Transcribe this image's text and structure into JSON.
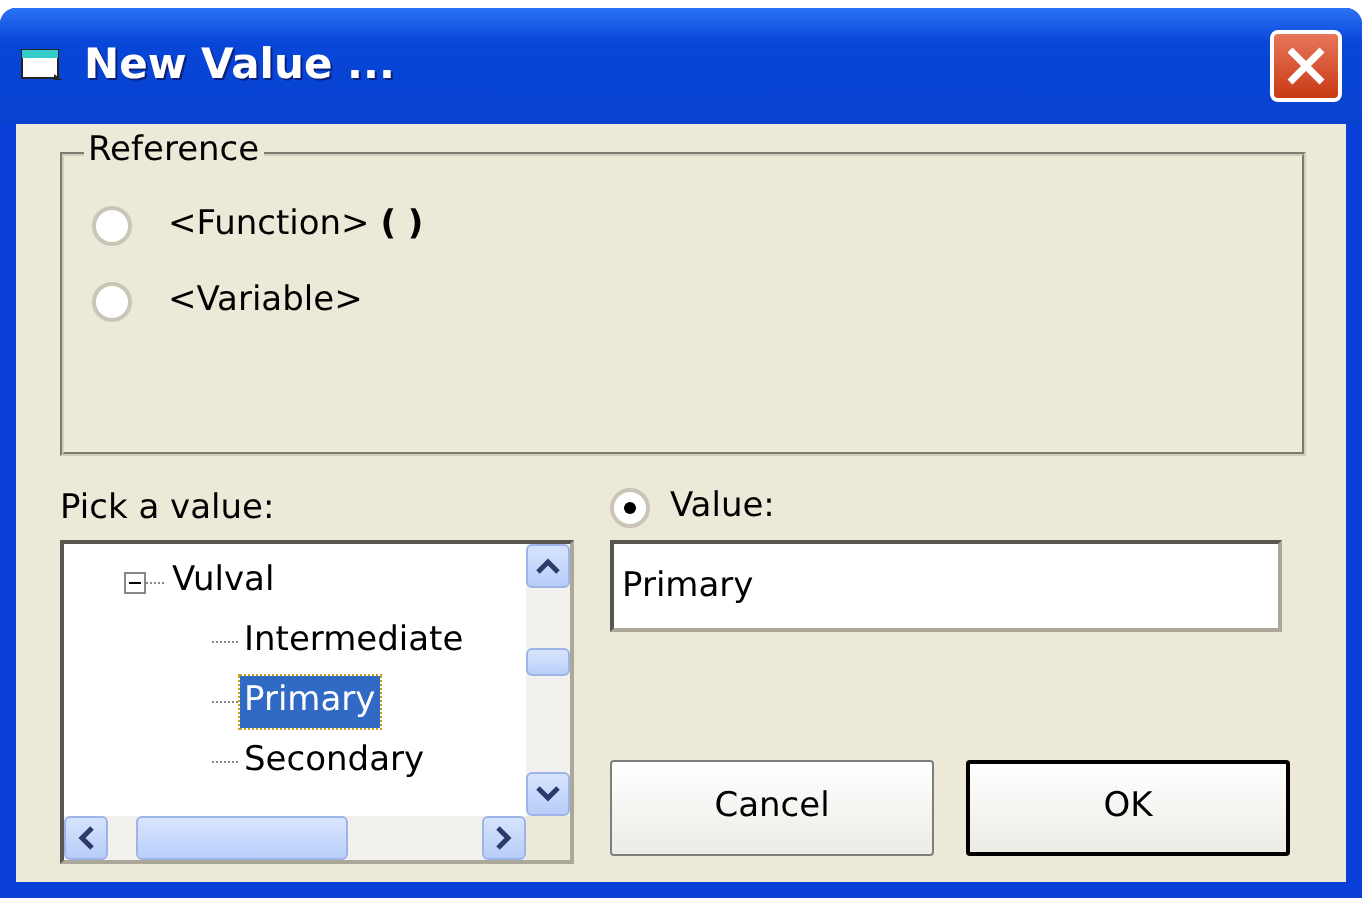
{
  "window": {
    "title": "New Value ..."
  },
  "reference": {
    "label": "Reference",
    "options": [
      {
        "label": "<Function> **( )**",
        "selected": false
      },
      {
        "label": "<Variable>",
        "selected": false
      }
    ]
  },
  "pick": {
    "label": "Pick a value:",
    "tree": [
      {
        "label": "Vulval",
        "expanded": true,
        "selected": false,
        "children": [
          {
            "label": "Intermediate",
            "selected": false
          },
          {
            "label": "Primary",
            "selected": true
          },
          {
            "label": "Secondary",
            "selected": false
          }
        ]
      }
    ]
  },
  "value_option": {
    "label": "Value:",
    "selected": true
  },
  "value_field": {
    "value": "Primary"
  },
  "buttons": [
    {
      "label": "Cancel",
      "default": false
    },
    {
      "label": "OK",
      "default": true
    }
  ]
}
